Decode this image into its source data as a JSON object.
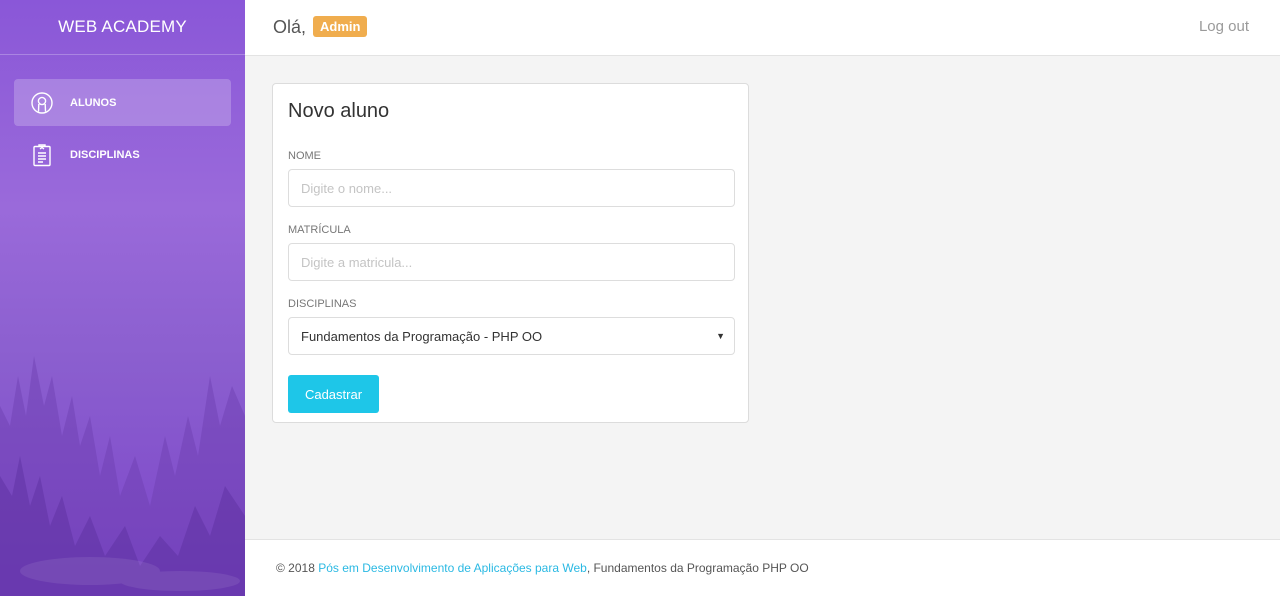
{
  "brand": "WEB ACADEMY",
  "sidebar": {
    "items": [
      {
        "label": "ALUNOS",
        "icon": "user-circle-icon",
        "active": true
      },
      {
        "label": "DISCIPLINAS",
        "icon": "clipboard-icon",
        "active": false
      }
    ]
  },
  "header": {
    "greeting": "Olá,",
    "user_badge": "Admin",
    "logout": "Log out"
  },
  "form": {
    "title": "Novo aluno",
    "nome_label": "NOME",
    "nome_placeholder": "Digite o nome...",
    "nome_value": "",
    "matricula_label": "MATRÍCULA",
    "matricula_placeholder": "Digite a matricula...",
    "matricula_value": "",
    "disciplinas_label": "DISCIPLINAS",
    "disciplina_selected": "Fundamentos da Programação - PHP OO",
    "submit_label": "Cadastrar"
  },
  "footer": {
    "prefix": "© 2018",
    "link": "Pós em Desenvolvimento de Aplicações para Web",
    "suffix": ", Fundamentos da Programação PHP OO"
  },
  "colors": {
    "sidebar": "#8a57d8",
    "badge": "#f0ad4e",
    "button": "#1ec6e8",
    "link": "#2bb9e3"
  }
}
